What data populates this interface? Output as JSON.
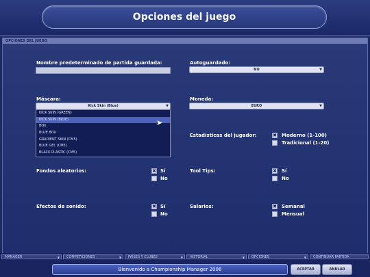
{
  "header": {
    "title": "Opciones del juego"
  },
  "panel": {
    "header": "OPCIONES DEL JUEGO"
  },
  "save_name": {
    "label": "Nombre predeterminado de partida guardada:",
    "value": ""
  },
  "autosave": {
    "label": "Autoguardado:",
    "value": "NO"
  },
  "skin": {
    "label": "Máscara:",
    "value": "Kick Skin (Blue)",
    "options": [
      "KICK SKIN (GREEN)",
      "KICK SKIN (BLUE)",
      "BOX",
      "BLUE BOX",
      "GRADIENT SKIN (CM5)",
      "BLUE GEL (CM5)",
      "BLACK PLASTIC (CM5)"
    ]
  },
  "currency": {
    "label": "Moneda:",
    "value": "EURO"
  },
  "player_stats": {
    "label": "Estadísticas del jugador:",
    "option1": "Moderno (1-100)",
    "option2": "Tradicional (1-20)"
  },
  "random_backgrounds": {
    "label": "Fondos aleatorios:",
    "yes": "Sí",
    "no": "No"
  },
  "tooltips": {
    "label": "Tool Tips:",
    "yes": "Sí",
    "no": "No"
  },
  "sound_effects": {
    "label": "Efectos de sonido:",
    "yes": "Sí",
    "no": "No"
  },
  "salaries": {
    "label": "Salarios:",
    "option1": "Semanal",
    "option2": "Mensual"
  },
  "nav": {
    "tabs": [
      "MANAGER",
      "COMPETICIONES",
      "PAÍSES Y CLUBES",
      "HISTORIAL",
      "OPCIONES",
      "CONTINUAR PARTIDA"
    ]
  },
  "status": {
    "text": "Bienvenido a Championship Manager 2006"
  },
  "buttons": {
    "accept": "ACEPTAR",
    "cancel": "ANULAR"
  },
  "icons": {
    "check": "check-mark-icon",
    "dropdown": "chevron-down-icon",
    "cursor": "mouse-pointer-icon"
  },
  "colors": {
    "background": "#1b2a63",
    "highlight": "#4d62b8",
    "status": "#4a62c6"
  }
}
